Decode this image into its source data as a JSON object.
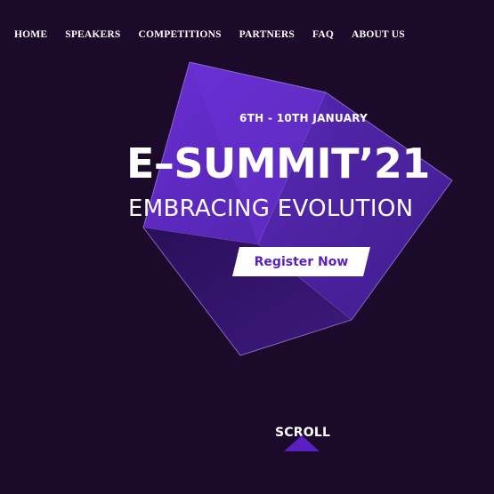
{
  "nav": {
    "items": [
      {
        "label": "HOME"
      },
      {
        "label": "SPEAKERS"
      },
      {
        "label": "COMPETITIONS"
      },
      {
        "label": "PARTNERS"
      },
      {
        "label": "FAQ"
      },
      {
        "label": "ABOUT US"
      }
    ]
  },
  "hero": {
    "date": "6TH - 10TH JANUARY",
    "title": "E–SUMMIT’21",
    "tagline": "EMBRACING EVOLUTION",
    "register_label": "Register Now"
  },
  "scroll": {
    "label": "SCROLL",
    "icon": "triangle-up-icon"
  },
  "colors": {
    "background": "#1c0a2b",
    "accent": "#5a1fc0",
    "button_text": "#5a1fc0"
  }
}
